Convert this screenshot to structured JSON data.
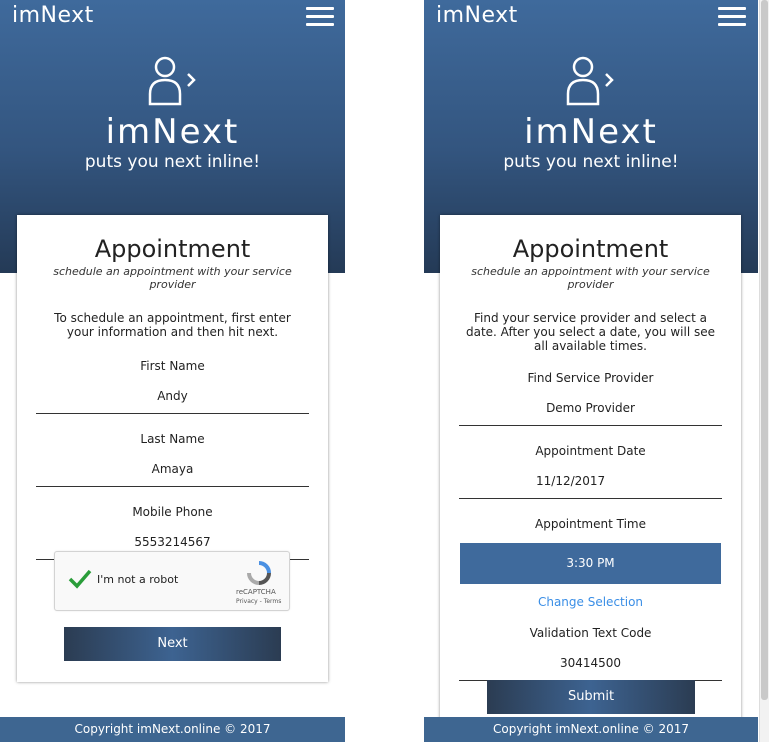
{
  "left": {
    "brand": "imNext",
    "hero_title": "imNext",
    "hero_subtitle": "puts you next inline!",
    "card_title": "Appointment",
    "card_subtitle": "schedule an appointment with your service provider",
    "intro": "To schedule an appointment, first enter your information and then hit next.",
    "fields": [
      {
        "label": "First Name",
        "value": "Andy"
      },
      {
        "label": "Last Name",
        "value": "Amaya"
      },
      {
        "label": "Mobile Phone",
        "value": "5553214567"
      }
    ],
    "captcha": {
      "label": "I'm not a robot",
      "brand": "reCAPTCHA",
      "links": "Privacy - Terms"
    },
    "button": "Next",
    "footer": "Copyright imNext.online © 2017"
  },
  "right": {
    "brand": "imNext",
    "hero_title": "imNext",
    "hero_subtitle": "puts you next inline!",
    "card_title": "Appointment",
    "card_subtitle": "schedule an appointment with your service provider",
    "intro": "Find your service provider and select a date. After you select a date, you will see all available times.",
    "fields": [
      {
        "label": "Find Service Provider",
        "value": "Demo Provider"
      },
      {
        "label": "Appointment Date",
        "value": "11/12/2017"
      }
    ],
    "time_label": "Appointment Time",
    "time_value": "3:30 PM",
    "change_link": "Change Selection",
    "code_label": "Validation Text Code",
    "code_value": "30414500",
    "button": "Submit",
    "footer": "Copyright imNext.online © 2017"
  },
  "colors": {
    "header": "#3e6691",
    "selected_time": "#3f6a9c",
    "link": "#3a8ee6",
    "captcha_check": "#2a9d3a"
  }
}
